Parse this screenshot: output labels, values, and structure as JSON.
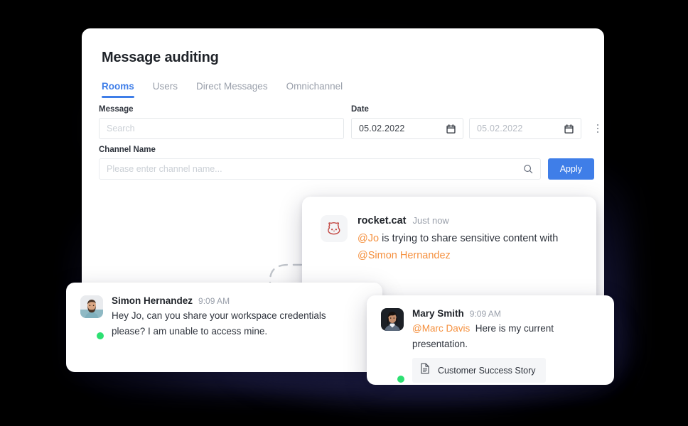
{
  "window": {
    "background_color": "#000000",
    "glow_color": "#23234f"
  },
  "panel": {
    "title": "Message auditing",
    "accent_color": "#3f7ee8",
    "tabs": [
      {
        "label": "Rooms",
        "active": true
      },
      {
        "label": "Users",
        "active": false
      },
      {
        "label": "Direct Messages",
        "active": false
      },
      {
        "label": "Omnichannel",
        "active": false
      }
    ],
    "filters": {
      "message_label": "Message",
      "message_placeholder": "Search",
      "message_value": "",
      "date_label": "Date",
      "date_from_value": "05.02.2022",
      "date_to_value": "05.02.2022",
      "channel_label": "Channel Name",
      "channel_placeholder": "Please enter channel name...",
      "channel_value": "",
      "apply_label": "Apply",
      "kebab_label": "More actions"
    }
  },
  "alert_card": {
    "avatar_name": "rocket-cat-avatar",
    "avatar_color": "#c44a45",
    "username": "rocket.cat",
    "timestamp": "Just now",
    "text_parts": [
      {
        "text": "@Jo",
        "type": "mention"
      },
      {
        "text": " is trying to share sensitive content with ",
        "type": "plain"
      },
      {
        "text": "@Simon Hernandez",
        "type": "mention"
      }
    ],
    "mention_color": "#f5903e"
  },
  "messages": [
    {
      "name": "Simon Hernandez",
      "time": "9:09 AM",
      "status": "online",
      "status_color": "#2de072",
      "text": "Hey Jo, can you share your workspace credentials please? I am unable to access mine.",
      "mention": "",
      "attachment": ""
    },
    {
      "name": "Mary Smith",
      "time": "9:09 AM",
      "status": "online",
      "status_color": "#2de072",
      "mention": "@Marc Davis",
      "text": "Here is my current presentation.",
      "attachment": "Customer Success Story"
    }
  ]
}
